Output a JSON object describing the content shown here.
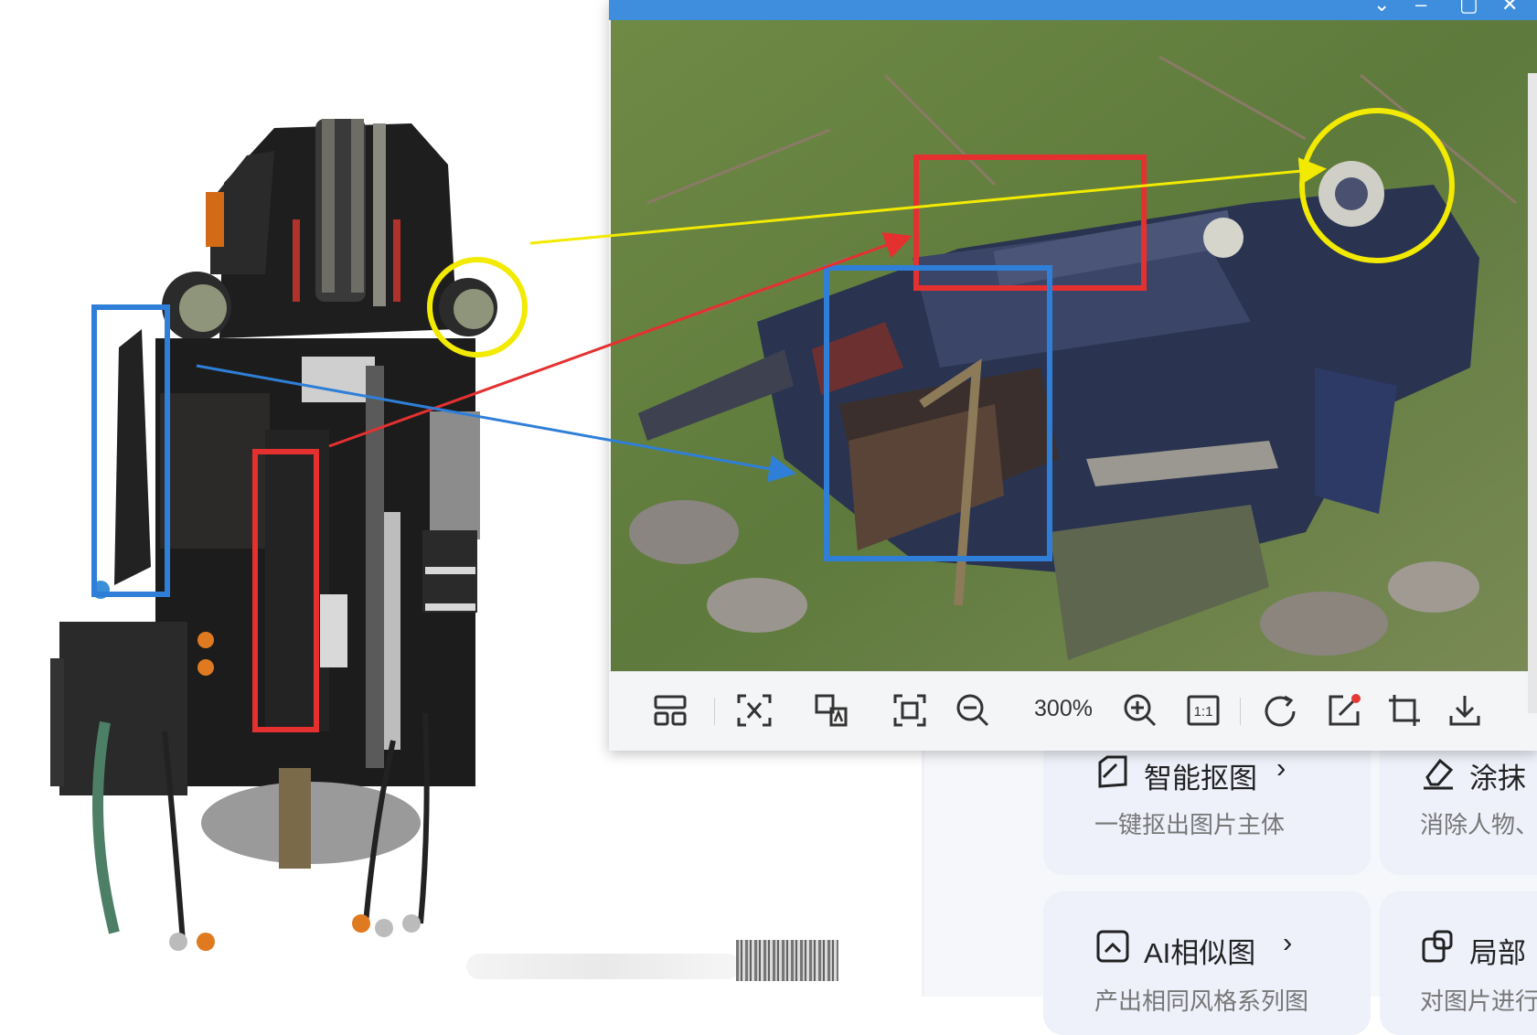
{
  "viewer": {
    "zoom": "300%",
    "toolbar_buttons": [
      "layout-icon",
      "ocr-icon",
      "translate-icon",
      "fit-screen-icon",
      "zoom-out-icon",
      "zoom-in-icon",
      "actual-size-icon",
      "rotate-icon",
      "edit-icon",
      "crop-icon",
      "download-icon"
    ],
    "actual_size_label": "1:1"
  },
  "side_panel": {
    "cards": [
      {
        "title": "智能抠图",
        "subtitle": "一键抠出图片主体"
      },
      {
        "title": "涂抹",
        "subtitle": "消除人物、"
      },
      {
        "title": "AI相似图",
        "subtitle": "产出相同风格系列图"
      },
      {
        "title": "局部",
        "subtitle": "对图片进行"
      }
    ],
    "chevron": "›"
  },
  "colors": {
    "titlebar": "#3f8ede",
    "blue_box": "#2f7fd8",
    "red_box": "#e53030",
    "yellow_circle": "#f2ea00"
  }
}
